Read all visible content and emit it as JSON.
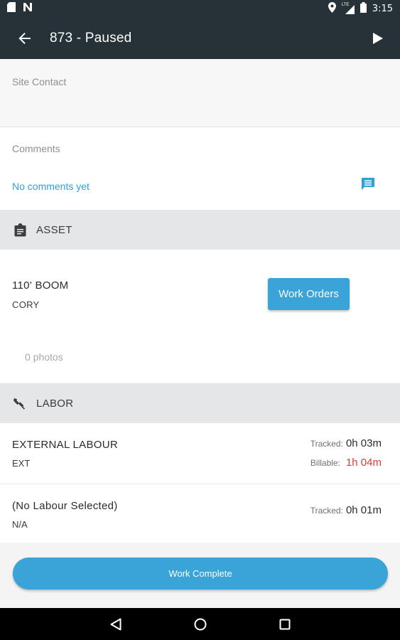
{
  "status_bar": {
    "time": "3:15",
    "network_label": "LTE"
  },
  "app_bar": {
    "title": "873 - Paused"
  },
  "site_contact": {
    "label": "Site Contact"
  },
  "comments": {
    "label": "Comments",
    "empty_text": "No comments yet"
  },
  "asset_section": {
    "header": "ASSET",
    "name": "110' BOOM",
    "subtitle": "CORY",
    "work_orders_button": "Work Orders",
    "photos": "0 photos"
  },
  "labor_section": {
    "header": "LABOR",
    "items": [
      {
        "name": "EXTERNAL LABOUR",
        "code": "EXT",
        "tracked_label": "Tracked:",
        "tracked": "0h 03m",
        "billable_label": "Billable:",
        "billable": "1h 04m"
      },
      {
        "name": "(No Labour Selected)",
        "code": "N/A",
        "tracked_label": "Tracked:",
        "tracked": "0h 01m"
      }
    ]
  },
  "footer": {
    "complete_button": "Work Complete"
  },
  "colors": {
    "app_bar": "#263238",
    "accent": "#3aa4d9",
    "link": "#2ea2d6",
    "billable": "#e53935"
  }
}
